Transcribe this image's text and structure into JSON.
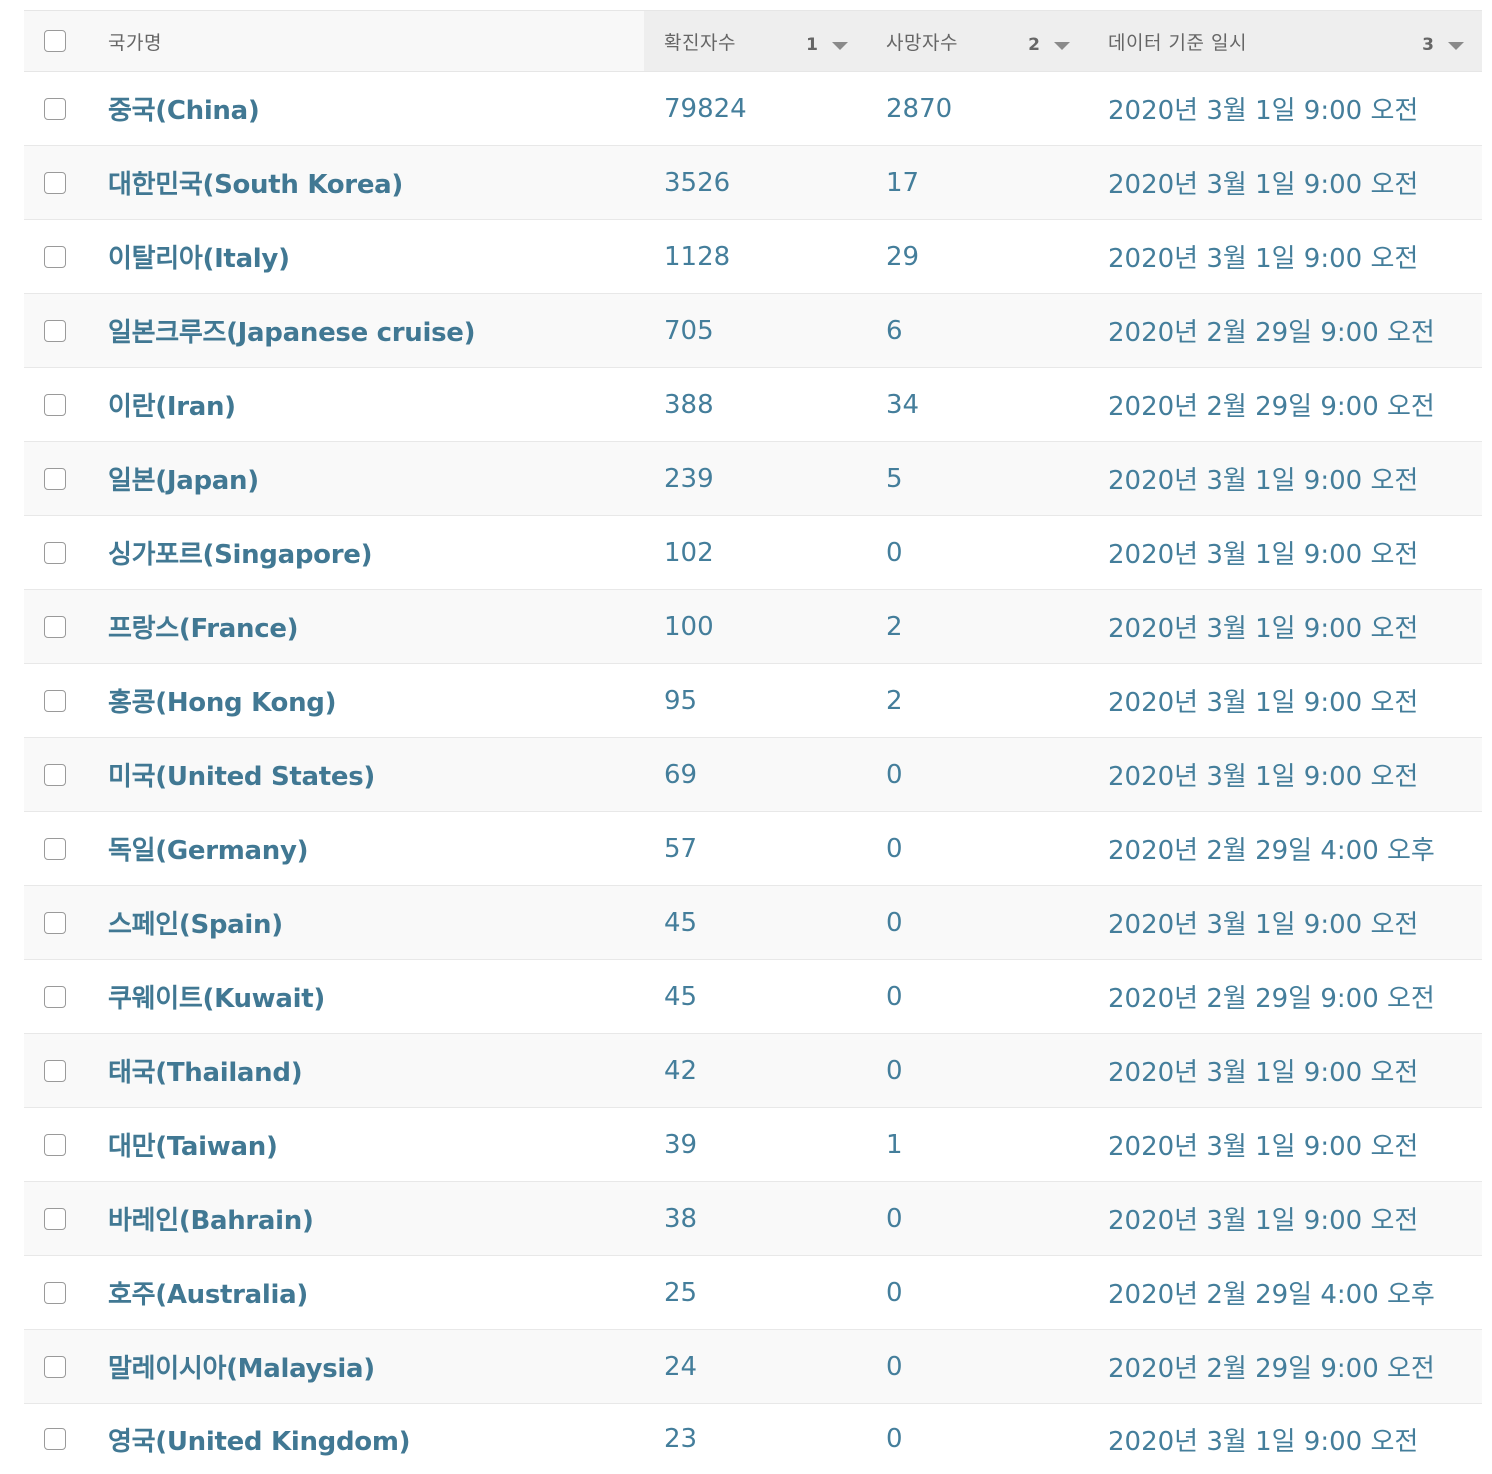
{
  "columns": {
    "name": "국가명",
    "confirmed": "확진자수",
    "confirmed_sort_priority": "1",
    "deaths": "사망자수",
    "deaths_sort_priority": "2",
    "date": "데이터 기준 일시",
    "date_sort_priority": "3"
  },
  "rows": [
    {
      "name": "중국(China)",
      "confirmed": "79824",
      "deaths": "2870",
      "date": "2020년 3월 1일 9:00 오전"
    },
    {
      "name": "대한민국(South Korea)",
      "confirmed": "3526",
      "deaths": "17",
      "date": "2020년 3월 1일 9:00 오전"
    },
    {
      "name": "이탈리아(Italy)",
      "confirmed": "1128",
      "deaths": "29",
      "date": "2020년 3월 1일 9:00 오전"
    },
    {
      "name": "일본크루즈(Japanese cruise)",
      "confirmed": "705",
      "deaths": "6",
      "date": "2020년 2월 29일 9:00 오전"
    },
    {
      "name": "이란(Iran)",
      "confirmed": "388",
      "deaths": "34",
      "date": "2020년 2월 29일 9:00 오전"
    },
    {
      "name": "일본(Japan)",
      "confirmed": "239",
      "deaths": "5",
      "date": "2020년 3월 1일 9:00 오전"
    },
    {
      "name": "싱가포르(Singapore)",
      "confirmed": "102",
      "deaths": "0",
      "date": "2020년 3월 1일 9:00 오전"
    },
    {
      "name": "프랑스(France)",
      "confirmed": "100",
      "deaths": "2",
      "date": "2020년 3월 1일 9:00 오전"
    },
    {
      "name": "홍콩(Hong Kong)",
      "confirmed": "95",
      "deaths": "2",
      "date": "2020년 3월 1일 9:00 오전"
    },
    {
      "name": "미국(United States)",
      "confirmed": "69",
      "deaths": "0",
      "date": "2020년 3월 1일 9:00 오전"
    },
    {
      "name": "독일(Germany)",
      "confirmed": "57",
      "deaths": "0",
      "date": "2020년 2월 29일 4:00 오후"
    },
    {
      "name": "스페인(Spain)",
      "confirmed": "45",
      "deaths": "0",
      "date": "2020년 3월 1일 9:00 오전"
    },
    {
      "name": "쿠웨이트(Kuwait)",
      "confirmed": "45",
      "deaths": "0",
      "date": "2020년 2월 29일 9:00 오전"
    },
    {
      "name": "태국(Thailand)",
      "confirmed": "42",
      "deaths": "0",
      "date": "2020년 3월 1일 9:00 오전"
    },
    {
      "name": "대만(Taiwan)",
      "confirmed": "39",
      "deaths": "1",
      "date": "2020년 3월 1일 9:00 오전"
    },
    {
      "name": "바레인(Bahrain)",
      "confirmed": "38",
      "deaths": "0",
      "date": "2020년 3월 1일 9:00 오전"
    },
    {
      "name": "호주(Australia)",
      "confirmed": "25",
      "deaths": "0",
      "date": "2020년 2월 29일 4:00 오후"
    },
    {
      "name": "말레이시아(Malaysia)",
      "confirmed": "24",
      "deaths": "0",
      "date": "2020년 2월 29일 9:00 오전"
    },
    {
      "name": "영국(United Kingdom)",
      "confirmed": "23",
      "deaths": "0",
      "date": "2020년 3월 1일 9:00 오전"
    }
  ]
}
